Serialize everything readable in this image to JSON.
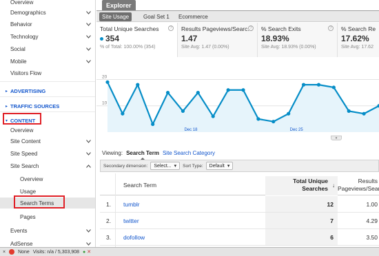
{
  "sidebar": {
    "items": [
      {
        "label": "Overview",
        "kind": "item",
        "chevron": false
      },
      {
        "label": "Demographics",
        "kind": "item",
        "chevron": "down"
      },
      {
        "label": "Behavior",
        "kind": "item",
        "chevron": "down"
      },
      {
        "label": "Technology",
        "kind": "item",
        "chevron": "down"
      },
      {
        "label": "Social",
        "kind": "item",
        "chevron": "down"
      },
      {
        "label": "Mobile",
        "kind": "item",
        "chevron": "down"
      },
      {
        "label": "Visitors Flow",
        "kind": "item",
        "chevron": false
      },
      {
        "label": "ADVERTISING",
        "kind": "section",
        "chevron": false
      },
      {
        "label": "TRAFFIC SOURCES",
        "kind": "section",
        "chevron": false
      },
      {
        "label": "CONTENT",
        "kind": "section-open",
        "chevron": false
      },
      {
        "label": "Overview",
        "kind": "item",
        "chevron": false
      },
      {
        "label": "Site Content",
        "kind": "item",
        "chevron": "down"
      },
      {
        "label": "Site Speed",
        "kind": "item",
        "chevron": "down"
      },
      {
        "label": "Site Search",
        "kind": "item",
        "chevron": "up"
      },
      {
        "label": "Overview",
        "kind": "sub",
        "chevron": false
      },
      {
        "label": "Usage",
        "kind": "sub",
        "chevron": false
      },
      {
        "label": "Search Terms",
        "kind": "sub-selected",
        "chevron": false
      },
      {
        "label": "Pages",
        "kind": "sub",
        "chevron": false
      },
      {
        "label": "Events",
        "kind": "item",
        "chevron": "down"
      },
      {
        "label": "AdSense",
        "kind": "item",
        "chevron": "down"
      }
    ]
  },
  "header": {
    "explorer_tab": "Explorer",
    "subtabs": [
      "Site Usage",
      "Goal Set 1",
      "Ecommerce"
    ]
  },
  "metrics": [
    {
      "label": "Total Unique Searches",
      "value": "354",
      "sub": "% of Total: 100.00% (354)",
      "selected": true
    },
    {
      "label": "Results Pageviews/Searc...",
      "value": "1.47",
      "sub": "Site Avg: 1.47 (0.00%)"
    },
    {
      "label": "% Search Exits",
      "value": "18.93%",
      "sub": "Site Avg: 18.93% (0.00%)"
    },
    {
      "label": "% Search Re",
      "value": "17.62%",
      "sub": "Site Avg: 17.62"
    }
  ],
  "chart_data": {
    "type": "area",
    "x_ticks": [
      "Dec 18",
      "Dec 25"
    ],
    "y_ticks": [
      "20",
      "10"
    ],
    "ylim": [
      0,
      23
    ],
    "grid": true,
    "series": [
      {
        "values": [
          19,
          7,
          18,
          3,
          15,
          8,
          15,
          6,
          16,
          16,
          5,
          4,
          7,
          18,
          18,
          17,
          8,
          7,
          10
        ]
      }
    ],
    "colors": {
      "line": "#058dc7",
      "fill": "#e6f4fb",
      "grid": "#e3e3e3"
    }
  },
  "viewing": {
    "label": "Viewing:",
    "active": "Search Term",
    "other": "Site Search Category"
  },
  "filters": {
    "secondary_label": "Secondary dimension:",
    "secondary_value": "Select...",
    "sort_label": "Sort Type:",
    "sort_value": "Default"
  },
  "table": {
    "col_term": "Search Term",
    "col_tus_line1": "Total Unique",
    "col_tus_line2": "Searches",
    "col_rpv_line1": "Results",
    "col_rpv_line2": "Pageviews/Search",
    "sort_icon": "↓",
    "rows": [
      {
        "idx": "1.",
        "term": "tumblr",
        "tus": "12",
        "rpv": "1.00"
      },
      {
        "idx": "2.",
        "term": "twitter",
        "tus": "7",
        "rpv": "4.29"
      },
      {
        "idx": "3.",
        "term": "dofollow",
        "tus": "6",
        "rpv": "3.50"
      }
    ]
  },
  "statusbar": {
    "close": "×",
    "none": "None",
    "visits": "Visits: n/a / 5,303,908"
  }
}
